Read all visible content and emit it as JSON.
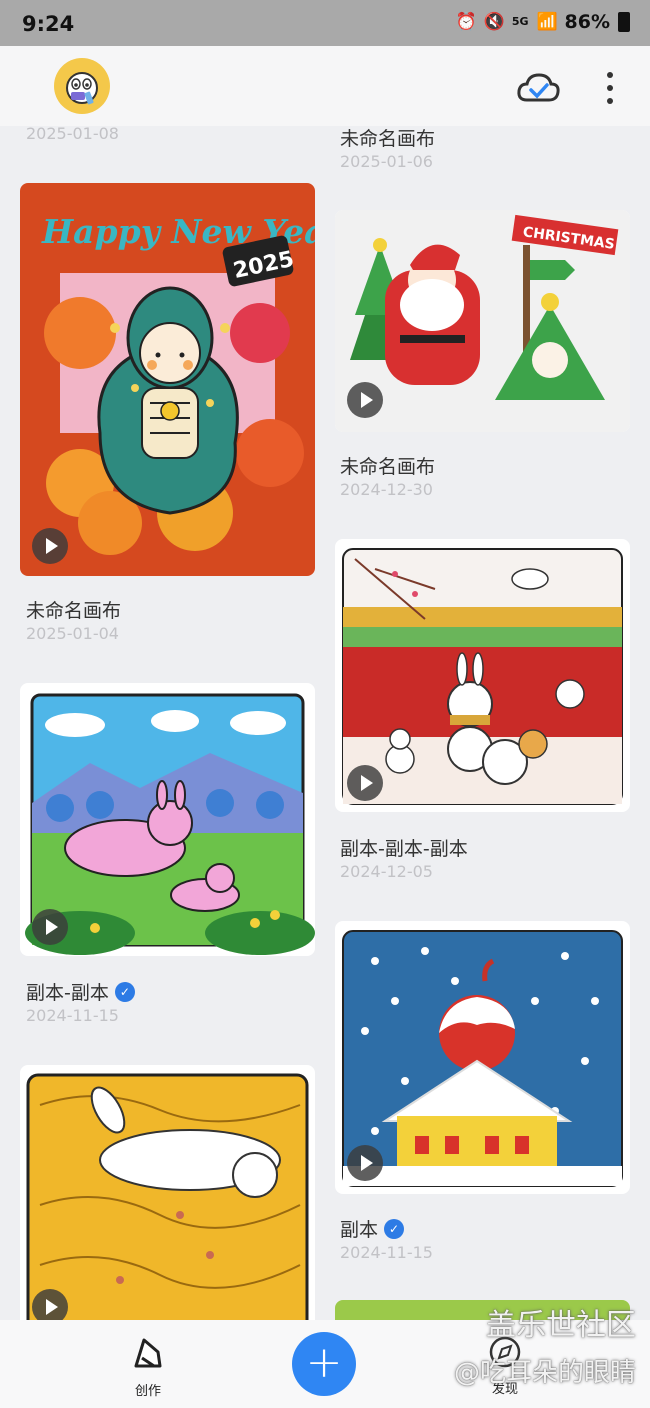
{
  "status_bar": {
    "time": "9:24",
    "network": "5G",
    "battery": "86%"
  },
  "colors": {
    "accent": "#2f86f3",
    "verified": "#2d7be5"
  },
  "left_column": [
    {
      "date": "2025-01-08"
    },
    {
      "title": "未命名画布",
      "date": "2025-01-04",
      "canvas_text": "Happy New Year",
      "canvas_year": "2025",
      "has_video": true
    },
    {
      "title": "副本-副本",
      "date": "2024-11-15",
      "verified": true,
      "has_video": true
    },
    {
      "has_video": true
    }
  ],
  "right_column": [
    {
      "title": "未命名画布",
      "date": "2025-01-06"
    },
    {
      "title": "未命名画布",
      "date": "2024-12-30",
      "canvas_text": "CHRISTMAS",
      "has_video": true
    },
    {
      "title": "副本-副本-副本",
      "date": "2024-12-05",
      "has_video": true
    },
    {
      "title": "副本",
      "date": "2024-11-15",
      "verified": true,
      "has_video": true
    }
  ],
  "bottom_nav": {
    "create_label": "创作",
    "discover_label": "发现"
  },
  "watermark": {
    "line1": "盖乐世社区",
    "line2": "@吃耳朵的眼睛"
  }
}
